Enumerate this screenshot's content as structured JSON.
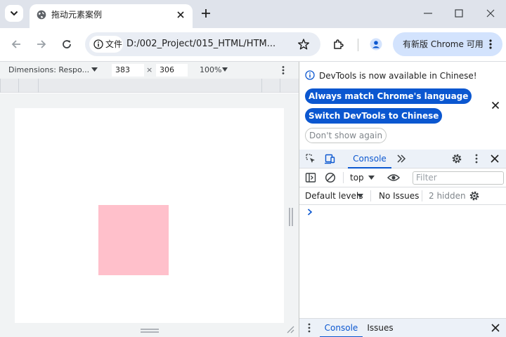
{
  "tab": {
    "title": "拖动元素案例"
  },
  "omnibox": {
    "chip_label": "文件",
    "url": "D:/002_Project/015_HTML/HTM..."
  },
  "update": {
    "label": "有新版 Chrome 可用"
  },
  "device_toolbar": {
    "dimensions_label": "Dimensions: Respo...",
    "width": "383",
    "height": "306",
    "times": "×",
    "zoom": "100%"
  },
  "page": {
    "box_color": "#ffc0cb"
  },
  "devtools": {
    "info": {
      "message": "DevTools is now available in Chinese!",
      "btn_match": "Always match Chrome's language",
      "btn_switch": "Switch DevTools to Chinese",
      "btn_dont_show": "Don't show again"
    },
    "tabs": {
      "console": "Console"
    },
    "console_toolbar": {
      "context": "top",
      "filter_placeholder": "Filter"
    },
    "levels": {
      "label": "Default levels",
      "issues": "No Issues",
      "hidden": "2 hidden"
    },
    "drawer": {
      "console": "Console",
      "issues": "Issues"
    }
  },
  "colors": {
    "accent": "#0b57d0",
    "tabstrip": "#dfe3eb",
    "update_pill": "#d3e3fd"
  },
  "icons": [
    "tab-search-icon",
    "globe-icon",
    "close-icon",
    "plus-icon",
    "minimize-icon",
    "maximize-icon",
    "back-icon",
    "forward-icon",
    "reload-icon",
    "info-icon",
    "star-icon",
    "extensions-icon",
    "profile-icon",
    "more-icon",
    "inspect-icon",
    "device-icon",
    "chevron-double-icon",
    "gear-icon",
    "sidebar-icon",
    "clear-icon",
    "eye-icon"
  ]
}
